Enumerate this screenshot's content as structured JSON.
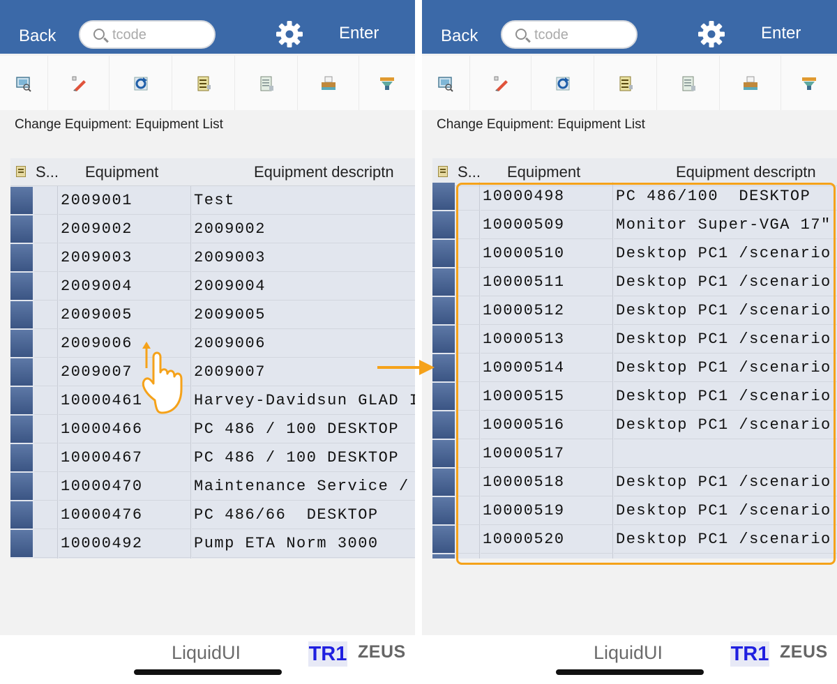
{
  "header": {
    "back_label": "Back",
    "search_placeholder": "tcode",
    "gear_icon": "gear-icon",
    "enter_label": "Enter"
  },
  "toolbar": {
    "icons": [
      "display-icon",
      "edit-pencil-icon",
      "refresh-icon",
      "details-list-icon",
      "document-icon",
      "print-icon",
      "filter-icon"
    ]
  },
  "page": {
    "title": "Change Equipment: Equipment List"
  },
  "grid": {
    "columns": [
      "S...",
      "Equipment",
      "Equipment descriptn"
    ]
  },
  "left_panel": {
    "rows": [
      {
        "equipment": "2009001",
        "description": "Test"
      },
      {
        "equipment": "2009002",
        "description": "2009002"
      },
      {
        "equipment": "2009003",
        "description": "2009003"
      },
      {
        "equipment": "2009004",
        "description": "2009004"
      },
      {
        "equipment": "2009005",
        "description": "2009005"
      },
      {
        "equipment": "2009006",
        "description": "2009006"
      },
      {
        "equipment": "2009007",
        "description": "2009007"
      },
      {
        "equipment": "10000461",
        "description": "Harvey-Davidsun GLAD I"
      },
      {
        "equipment": "10000466",
        "description": "PC 486 / 100 DESKTOP"
      },
      {
        "equipment": "10000467",
        "description": "PC 486 / 100 DESKTOP"
      },
      {
        "equipment": "10000470",
        "description": "Maintenance Service /"
      },
      {
        "equipment": "10000476",
        "description": "PC 486/66  DESKTOP"
      },
      {
        "equipment": "10000492",
        "description": "Pump ETA Norm 3000"
      }
    ]
  },
  "right_panel": {
    "rows": [
      {
        "equipment": "10000498",
        "description": "PC 486/100  DESKTOP"
      },
      {
        "equipment": "10000509",
        "description": "Monitor Super-VGA 17\""
      },
      {
        "equipment": "10000510",
        "description": "Desktop PC1 /scenario"
      },
      {
        "equipment": "10000511",
        "description": "Desktop PC1 /scenario"
      },
      {
        "equipment": "10000512",
        "description": "Desktop PC1 /scenario"
      },
      {
        "equipment": "10000513",
        "description": "Desktop PC1 /scenario"
      },
      {
        "equipment": "10000514",
        "description": "Desktop PC1 /scenario"
      },
      {
        "equipment": "10000515",
        "description": "Desktop PC1 /scenario"
      },
      {
        "equipment": "10000516",
        "description": "Desktop PC1 /scenario"
      },
      {
        "equipment": "10000517",
        "description": ""
      },
      {
        "equipment": "10000518",
        "description": "Desktop PC1 /scenario"
      },
      {
        "equipment": "10000519",
        "description": "Desktop PC1 /scenario"
      },
      {
        "equipment": "10000520",
        "description": "Desktop PC1 /scenario"
      }
    ]
  },
  "footer": {
    "brand": "LiquidUI",
    "system": "TR1",
    "server": "ZEUS"
  },
  "colors": {
    "header_blue": "#3b69a8",
    "annotation_orange": "#f5a21a",
    "system_badge_text": "#1f1fe0"
  },
  "annotations": {
    "swipe_gesture": "swipe-up-hand-icon",
    "transition_arrow": "arrow-right-icon"
  }
}
